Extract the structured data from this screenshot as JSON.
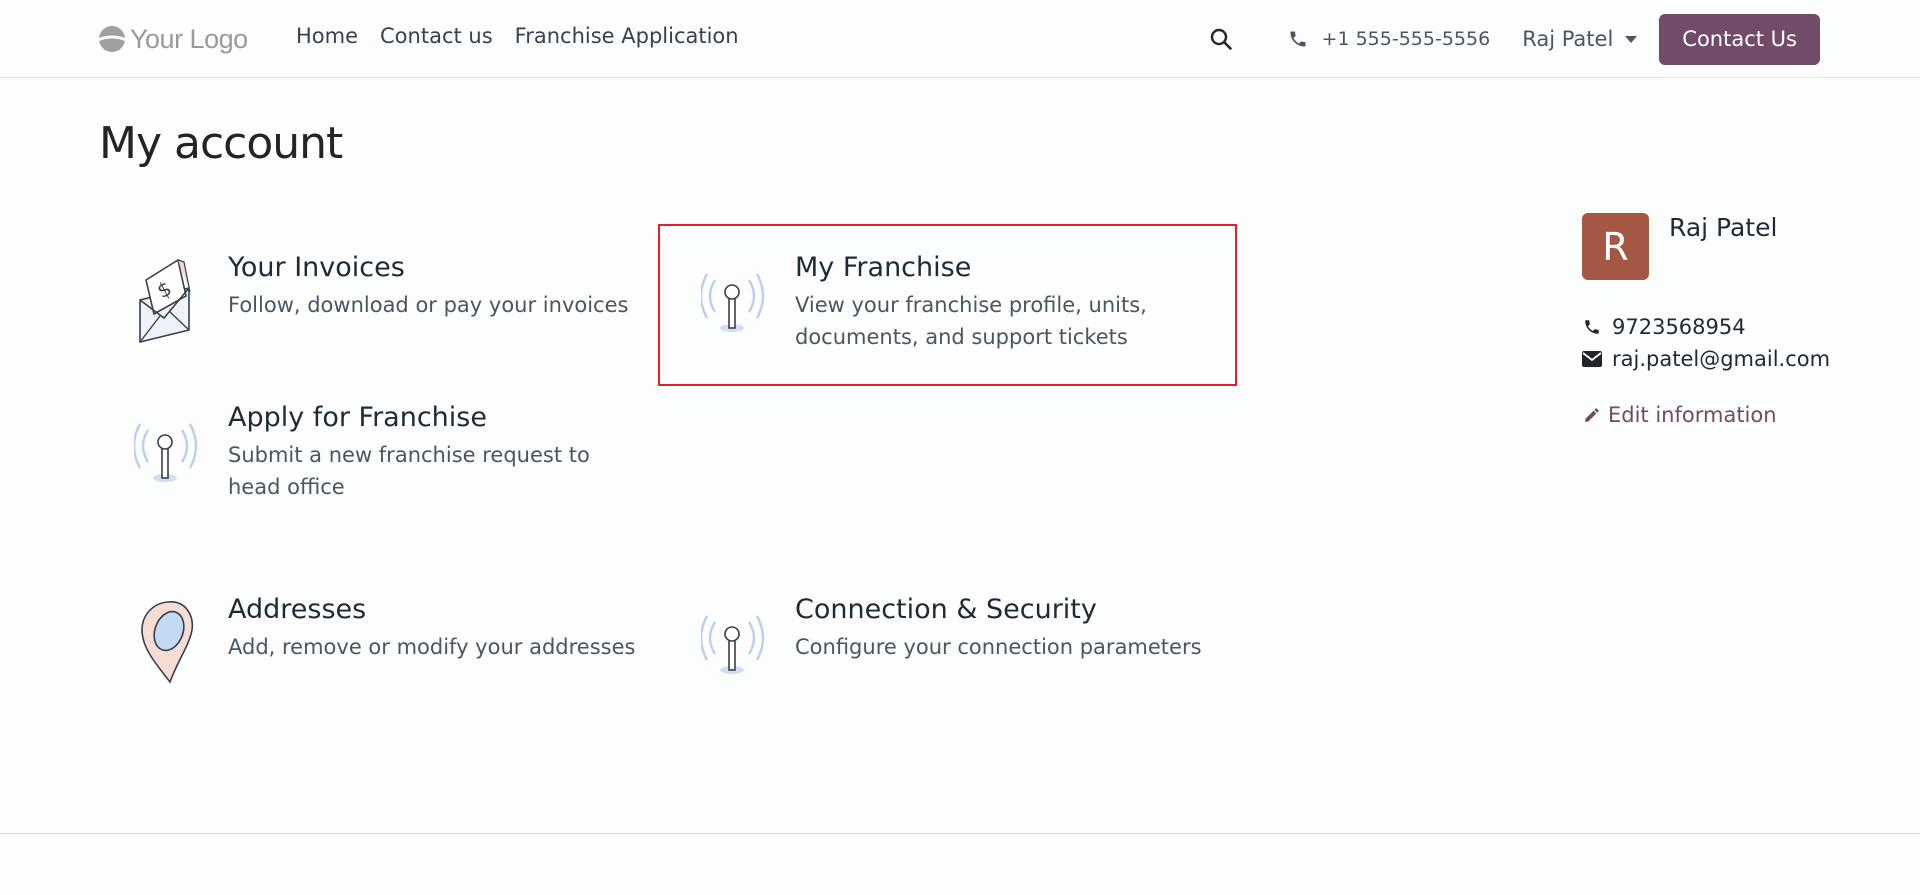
{
  "header": {
    "logo_text": "Your Logo",
    "nav": [
      "Home",
      "Contact us",
      "Franchise Application"
    ],
    "phone": "+1 555-555-5556",
    "user_name": "Raj Patel",
    "cta_label": "Contact Us",
    "accent_color": "#714b67"
  },
  "page": {
    "title": "My account"
  },
  "cards": [
    {
      "title": "Your Invoices",
      "description": "Follow, download or pay your invoices",
      "icon": "invoice-envelope-icon"
    },
    {
      "title": "My Franchise",
      "description": "View your franchise profile, units, documents, and support tickets",
      "icon": "antenna-icon"
    },
    {
      "title": "Apply for Franchise",
      "description": "Submit a new franchise request to head office",
      "icon": "antenna-icon"
    },
    {
      "title": "Addresses",
      "description": "Add, remove or modify your addresses",
      "icon": "map-pin-icon"
    },
    {
      "title": "Connection & Security",
      "description": "Configure your connection parameters",
      "icon": "antenna-icon"
    }
  ],
  "profile": {
    "initial": "R",
    "name": "Raj Patel",
    "phone": "9723568954",
    "email": "raj.patel@gmail.com",
    "edit_label": "Edit information",
    "avatar_color": "#a45743"
  }
}
